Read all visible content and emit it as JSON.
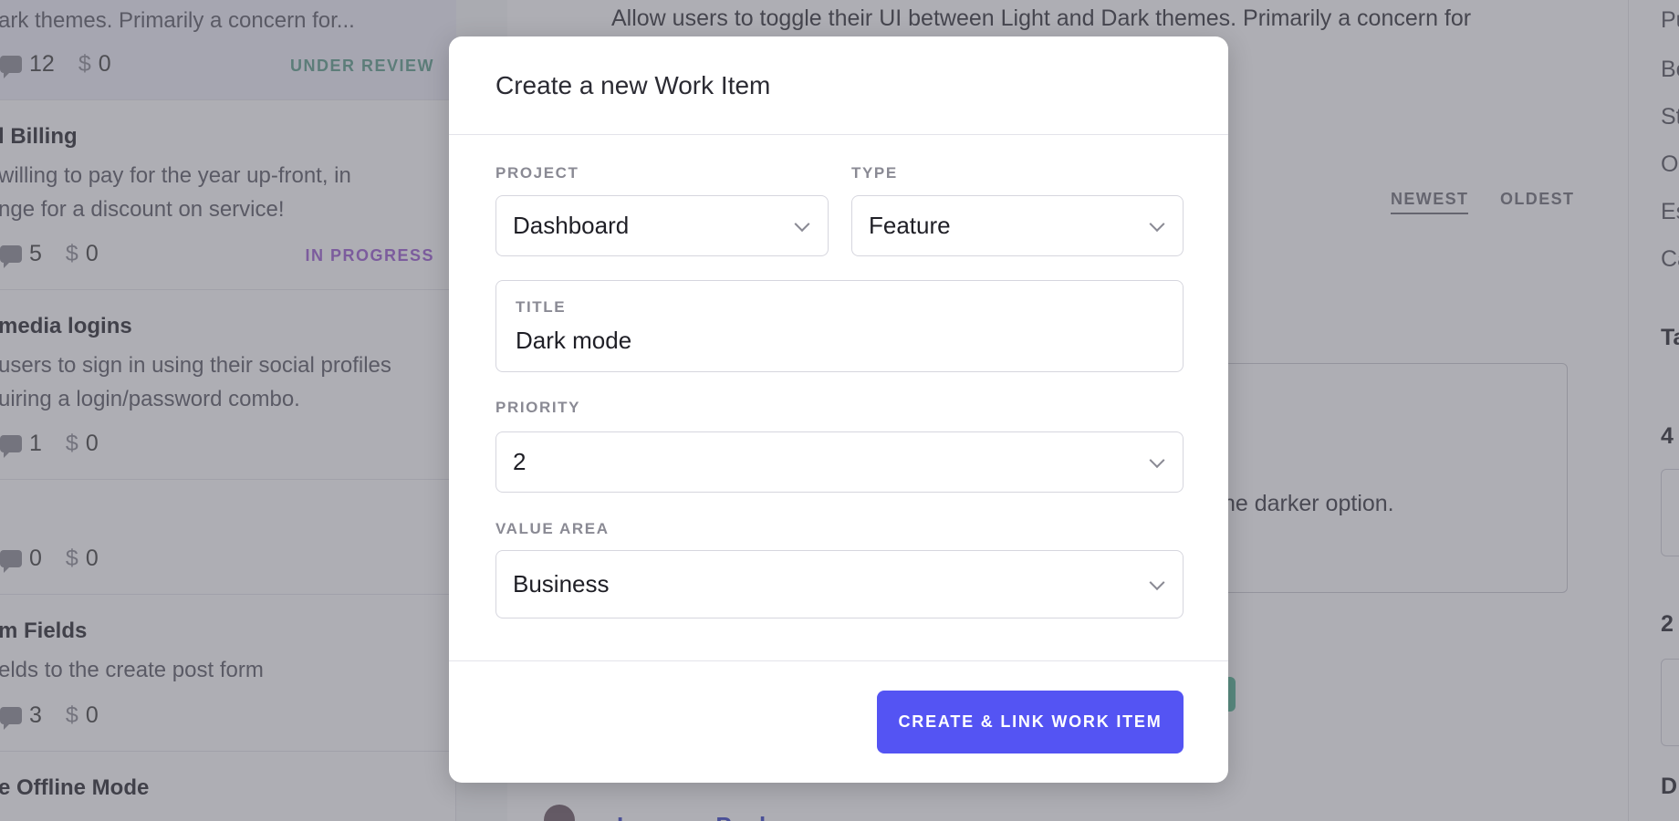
{
  "background": {
    "posts": [
      {
        "title": "",
        "description": "ark themes. Primarily a concern for...",
        "comments": "12",
        "money": "0",
        "status": "UNDER REVIEW",
        "status_color": "#5e9d8c",
        "highlight": true
      },
      {
        "title": "l Billing",
        "description": "willing to pay for the year up-front, in\nnge for a discount on service!",
        "comments": "5",
        "money": "0",
        "status": "IN PROGRESS",
        "status_color": "#9b5fd1",
        "highlight": false
      },
      {
        "title": " media logins",
        "description": "users to sign in using their social profiles\nuiring a login/password combo.",
        "comments": "1",
        "money": "0",
        "status": "",
        "status_color": "",
        "highlight": false
      },
      {
        "title": "",
        "description": "",
        "comments": "0",
        "money": "0",
        "status": "",
        "status_color": "",
        "highlight": false
      },
      {
        "title": "m Fields",
        "description": "elds to the create post form",
        "comments": "3",
        "money": "0",
        "status": "",
        "status_color": "",
        "highlight": false
      },
      {
        "title": "e Offline Mode",
        "description": "",
        "comments": "",
        "money": "",
        "status": "",
        "status_color": "",
        "highlight": false
      }
    ],
    "detail": {
      "description": "Allow users to toggle their UI between Light and Dark themes. Primarily a concern for",
      "sort_newest": "NEWEST",
      "sort_oldest": "OLDEST",
      "comment_fragment": "he darker option.",
      "comment_author": "Lorenzo Paolo"
    },
    "right_rail": [
      "Pu",
      "Bo",
      "St",
      "O",
      "Es",
      "Ca",
      "Ta",
      "4",
      "2",
      "D"
    ]
  },
  "modal": {
    "title": "Create a new Work Item",
    "project": {
      "label": "PROJECT",
      "value": "Dashboard"
    },
    "type": {
      "label": "TYPE",
      "value": "Feature"
    },
    "work_title": {
      "label": "TITLE",
      "value": "Dark mode"
    },
    "priority": {
      "label": "PRIORITY",
      "value": "2"
    },
    "value_area": {
      "label": "VALUE AREA",
      "value": "Business"
    },
    "submit_label": "CREATE & LINK WORK ITEM"
  },
  "colors": {
    "accent": "#5454f3",
    "under_review": "#5e9d8c",
    "in_progress": "#9b5fd1"
  }
}
